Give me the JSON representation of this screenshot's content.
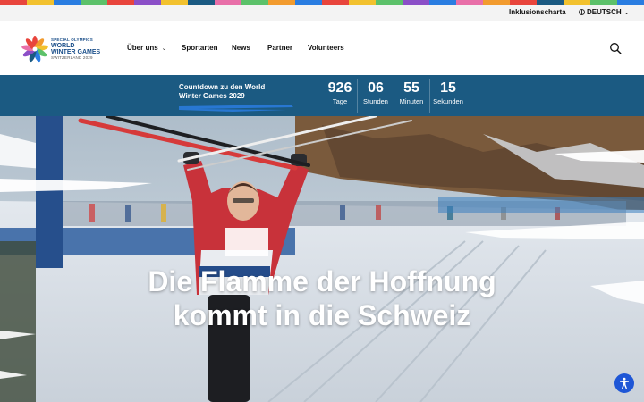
{
  "utility": {
    "inclusion_link": "Inklusionscharta",
    "language": "DEUTSCH",
    "language_icon": "globe-icon"
  },
  "logo": {
    "line1": "SPECIAL OLYMPICS",
    "line2": "WORLD",
    "line3": "WINTER GAMES",
    "line4": "SWITZERLAND 2029"
  },
  "nav": {
    "items": [
      {
        "label": "Über uns",
        "has_dropdown": true
      },
      {
        "label": "Sportarten",
        "has_dropdown": false
      },
      {
        "label": "News",
        "has_dropdown": false
      },
      {
        "label": "Partner",
        "has_dropdown": false
      },
      {
        "label": "Volunteers",
        "has_dropdown": false
      }
    ],
    "search_icon": "search-icon"
  },
  "countdown": {
    "label": "Countdown zu den World Winter Games 2029",
    "units": [
      {
        "value": "926",
        "label": "Tage"
      },
      {
        "value": "06",
        "label": "Stunden"
      },
      {
        "value": "55",
        "label": "Minuten"
      },
      {
        "value": "15",
        "label": "Sekunden"
      }
    ]
  },
  "hero": {
    "title_line1": "Die Flamme der Hoffnung",
    "title_line2": "kommt in die Schweiz"
  },
  "accessibility_icon": "accessibility-icon",
  "colors": {
    "countdown_bg": "#1b5a82",
    "accessibility_btn": "#1e56d6"
  }
}
